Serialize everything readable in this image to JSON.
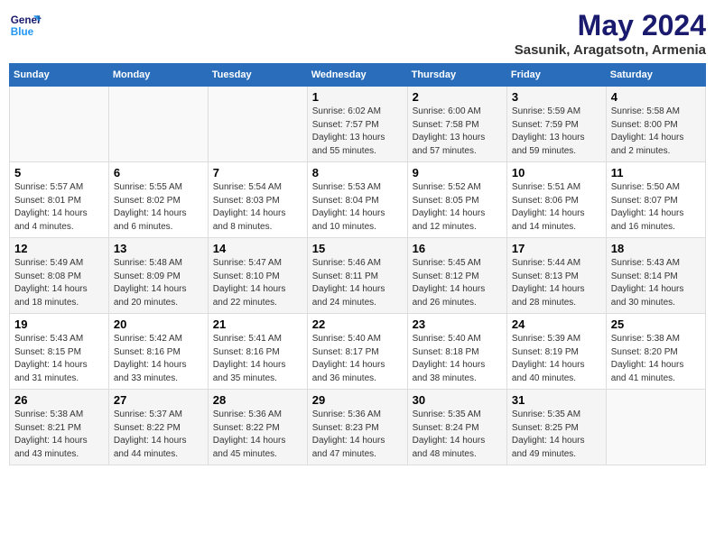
{
  "header": {
    "logo_line1": "General",
    "logo_line2": "Blue",
    "title": "May 2024",
    "subtitle": "Sasunik, Aragatsotn, Armenia"
  },
  "weekdays": [
    "Sunday",
    "Monday",
    "Tuesday",
    "Wednesday",
    "Thursday",
    "Friday",
    "Saturday"
  ],
  "weeks": [
    [
      {
        "day": "",
        "info": ""
      },
      {
        "day": "",
        "info": ""
      },
      {
        "day": "",
        "info": ""
      },
      {
        "day": "1",
        "info": "Sunrise: 6:02 AM\nSunset: 7:57 PM\nDaylight: 13 hours and 55 minutes."
      },
      {
        "day": "2",
        "info": "Sunrise: 6:00 AM\nSunset: 7:58 PM\nDaylight: 13 hours and 57 minutes."
      },
      {
        "day": "3",
        "info": "Sunrise: 5:59 AM\nSunset: 7:59 PM\nDaylight: 13 hours and 59 minutes."
      },
      {
        "day": "4",
        "info": "Sunrise: 5:58 AM\nSunset: 8:00 PM\nDaylight: 14 hours and 2 minutes."
      }
    ],
    [
      {
        "day": "5",
        "info": "Sunrise: 5:57 AM\nSunset: 8:01 PM\nDaylight: 14 hours and 4 minutes."
      },
      {
        "day": "6",
        "info": "Sunrise: 5:55 AM\nSunset: 8:02 PM\nDaylight: 14 hours and 6 minutes."
      },
      {
        "day": "7",
        "info": "Sunrise: 5:54 AM\nSunset: 8:03 PM\nDaylight: 14 hours and 8 minutes."
      },
      {
        "day": "8",
        "info": "Sunrise: 5:53 AM\nSunset: 8:04 PM\nDaylight: 14 hours and 10 minutes."
      },
      {
        "day": "9",
        "info": "Sunrise: 5:52 AM\nSunset: 8:05 PM\nDaylight: 14 hours and 12 minutes."
      },
      {
        "day": "10",
        "info": "Sunrise: 5:51 AM\nSunset: 8:06 PM\nDaylight: 14 hours and 14 minutes."
      },
      {
        "day": "11",
        "info": "Sunrise: 5:50 AM\nSunset: 8:07 PM\nDaylight: 14 hours and 16 minutes."
      }
    ],
    [
      {
        "day": "12",
        "info": "Sunrise: 5:49 AM\nSunset: 8:08 PM\nDaylight: 14 hours and 18 minutes."
      },
      {
        "day": "13",
        "info": "Sunrise: 5:48 AM\nSunset: 8:09 PM\nDaylight: 14 hours and 20 minutes."
      },
      {
        "day": "14",
        "info": "Sunrise: 5:47 AM\nSunset: 8:10 PM\nDaylight: 14 hours and 22 minutes."
      },
      {
        "day": "15",
        "info": "Sunrise: 5:46 AM\nSunset: 8:11 PM\nDaylight: 14 hours and 24 minutes."
      },
      {
        "day": "16",
        "info": "Sunrise: 5:45 AM\nSunset: 8:12 PM\nDaylight: 14 hours and 26 minutes."
      },
      {
        "day": "17",
        "info": "Sunrise: 5:44 AM\nSunset: 8:13 PM\nDaylight: 14 hours and 28 minutes."
      },
      {
        "day": "18",
        "info": "Sunrise: 5:43 AM\nSunset: 8:14 PM\nDaylight: 14 hours and 30 minutes."
      }
    ],
    [
      {
        "day": "19",
        "info": "Sunrise: 5:43 AM\nSunset: 8:15 PM\nDaylight: 14 hours and 31 minutes."
      },
      {
        "day": "20",
        "info": "Sunrise: 5:42 AM\nSunset: 8:16 PM\nDaylight: 14 hours and 33 minutes."
      },
      {
        "day": "21",
        "info": "Sunrise: 5:41 AM\nSunset: 8:16 PM\nDaylight: 14 hours and 35 minutes."
      },
      {
        "day": "22",
        "info": "Sunrise: 5:40 AM\nSunset: 8:17 PM\nDaylight: 14 hours and 36 minutes."
      },
      {
        "day": "23",
        "info": "Sunrise: 5:40 AM\nSunset: 8:18 PM\nDaylight: 14 hours and 38 minutes."
      },
      {
        "day": "24",
        "info": "Sunrise: 5:39 AM\nSunset: 8:19 PM\nDaylight: 14 hours and 40 minutes."
      },
      {
        "day": "25",
        "info": "Sunrise: 5:38 AM\nSunset: 8:20 PM\nDaylight: 14 hours and 41 minutes."
      }
    ],
    [
      {
        "day": "26",
        "info": "Sunrise: 5:38 AM\nSunset: 8:21 PM\nDaylight: 14 hours and 43 minutes."
      },
      {
        "day": "27",
        "info": "Sunrise: 5:37 AM\nSunset: 8:22 PM\nDaylight: 14 hours and 44 minutes."
      },
      {
        "day": "28",
        "info": "Sunrise: 5:36 AM\nSunset: 8:22 PM\nDaylight: 14 hours and 45 minutes."
      },
      {
        "day": "29",
        "info": "Sunrise: 5:36 AM\nSunset: 8:23 PM\nDaylight: 14 hours and 47 minutes."
      },
      {
        "day": "30",
        "info": "Sunrise: 5:35 AM\nSunset: 8:24 PM\nDaylight: 14 hours and 48 minutes."
      },
      {
        "day": "31",
        "info": "Sunrise: 5:35 AM\nSunset: 8:25 PM\nDaylight: 14 hours and 49 minutes."
      },
      {
        "day": "",
        "info": ""
      }
    ]
  ]
}
